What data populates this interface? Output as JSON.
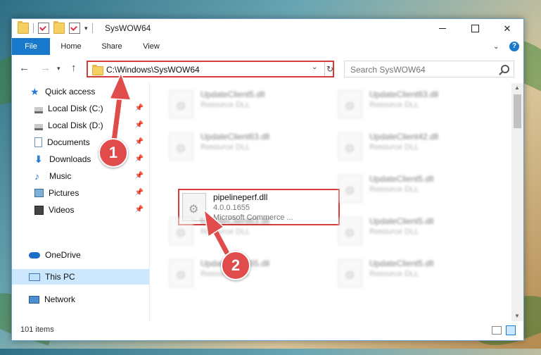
{
  "window": {
    "title": "SysWOW64",
    "minimize_glyph": "",
    "close_glyph": "✕"
  },
  "ribbon": {
    "tabs": [
      "File",
      "Home",
      "Share",
      "View"
    ],
    "help_glyph": "?"
  },
  "navigation": {
    "back_glyph": "←",
    "forward_glyph": "→",
    "up_glyph": "↑",
    "address": "C:\\Windows\\SysWOW64",
    "search_placeholder": "Search SysWOW64"
  },
  "sidebar": {
    "items": [
      {
        "label": "Quick access",
        "icon": "star-icon",
        "pinned": false,
        "selected": false
      },
      {
        "label": "Local Disk (C:)",
        "icon": "drive-icon",
        "pinned": true,
        "selected": false
      },
      {
        "label": "Local Disk (D:)",
        "icon": "drive-icon",
        "pinned": true,
        "selected": false
      },
      {
        "label": "Documents",
        "icon": "documents-icon",
        "pinned": true,
        "selected": false
      },
      {
        "label": "Downloads",
        "icon": "downloads-icon",
        "pinned": true,
        "selected": false
      },
      {
        "label": "Music",
        "icon": "music-icon",
        "pinned": true,
        "selected": false
      },
      {
        "label": "Pictures",
        "icon": "pictures-icon",
        "pinned": true,
        "selected": false
      },
      {
        "label": "Videos",
        "icon": "videos-icon",
        "pinned": true,
        "selected": false
      },
      {
        "label": "OneDrive",
        "icon": "onedrive-icon",
        "pinned": false,
        "selected": false
      },
      {
        "label": "This PC",
        "icon": "this-pc-icon",
        "pinned": false,
        "selected": true
      },
      {
        "label": "Network",
        "icon": "network-icon",
        "pinned": false,
        "selected": false
      }
    ]
  },
  "files": [
    {
      "name": "UpdateClient5.dll",
      "line1": "Resource DLL",
      "line2": "",
      "blurred": true,
      "highlighted": false
    },
    {
      "name": "UpdateClient63.dll",
      "line1": "Resource DLL",
      "line2": "",
      "blurred": true,
      "highlighted": false
    },
    {
      "name": "UpdateClient63.dll",
      "line1": "Resource DLL",
      "line2": "",
      "blurred": true,
      "highlighted": false
    },
    {
      "name": "UpdateClient42.dll",
      "line1": "Resource DLL",
      "line2": "",
      "blurred": true,
      "highlighted": false
    },
    {
      "name": "pipelineperf.dll",
      "line1": "4.0.0.1655",
      "line2": "Microsoft Commerce ...",
      "blurred": false,
      "highlighted": true
    },
    {
      "name": "UpdateClient5.dll",
      "line1": "Resource DLL",
      "line2": "",
      "blurred": true,
      "highlighted": false
    },
    {
      "name": "UpdateClient63.dll",
      "line1": "Resource DLL",
      "line2": "",
      "blurred": true,
      "highlighted": false
    },
    {
      "name": "UpdateClient5.dll",
      "line1": "Resource DLL",
      "line2": "",
      "blurred": true,
      "highlighted": false
    },
    {
      "name": "UpdateClient65.dll",
      "line1": "Resource DLL",
      "line2": "",
      "blurred": true,
      "highlighted": false
    },
    {
      "name": "UpdateClient5.dll",
      "line1": "Resource DLL",
      "line2": "",
      "blurred": true,
      "highlighted": false
    }
  ],
  "status": {
    "item_count": "101 items"
  },
  "callouts": [
    "1",
    "2"
  ],
  "colors": {
    "accent": "#1979ca",
    "highlight_border": "#d33a3a",
    "callout": "#e04b4b",
    "selection": "#cce8ff"
  }
}
